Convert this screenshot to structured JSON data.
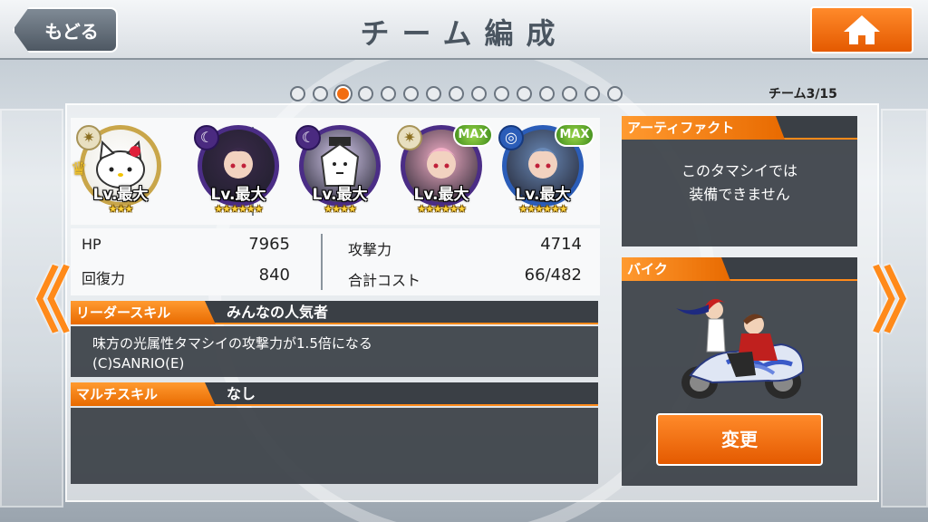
{
  "header": {
    "back_label": "もどる",
    "title": "チーム編成",
    "home_icon": "home-icon"
  },
  "pager": {
    "total_dots": 15,
    "active_index": 3,
    "team_count": "チーム3/15"
  },
  "team": {
    "members": [
      {
        "element": "light",
        "level": "Lv.最大",
        "stars": "★★★",
        "leader": true,
        "max": false,
        "frame": "gold"
      },
      {
        "element": "dark",
        "level": "Lv.最大",
        "stars": "★★★★★★",
        "leader": false,
        "max": false,
        "frame": "purple"
      },
      {
        "element": "dark",
        "level": "Lv.最大",
        "stars": "★★★★",
        "leader": false,
        "max": false,
        "frame": "purple"
      },
      {
        "element": "light",
        "level": "Lv.最大",
        "stars": "★★★★★★",
        "leader": false,
        "max": true,
        "max_label": "MAX",
        "frame": "purple"
      },
      {
        "element": "water",
        "level": "Lv.最大",
        "stars": "★★★★★★",
        "leader": false,
        "max": true,
        "max_label": "MAX",
        "frame": "blue"
      }
    ]
  },
  "stats": {
    "hp_label": "HP",
    "hp_value": "7965",
    "recovery_label": "回復力",
    "recovery_value": "840",
    "attack_label": "攻撃力",
    "attack_value": "4714",
    "cost_label": "合計コスト",
    "cost_value": "66/482"
  },
  "leader_skill": {
    "tag": "リーダースキル",
    "name": "みんなの人気者",
    "description": "味方の光属性タマシイの攻撃力が1.5倍になる",
    "copyright": "(C)SANRIO(E)"
  },
  "multi_skill": {
    "tag": "マルチスキル",
    "name": "なし"
  },
  "artifact": {
    "tag": "アーティファクト",
    "line1": "このタマシイでは",
    "line2": "装備できません"
  },
  "bike": {
    "tag": "バイク",
    "change_label": "変更"
  },
  "nav": {
    "prev_glyph": "《",
    "next_glyph": "》"
  }
}
